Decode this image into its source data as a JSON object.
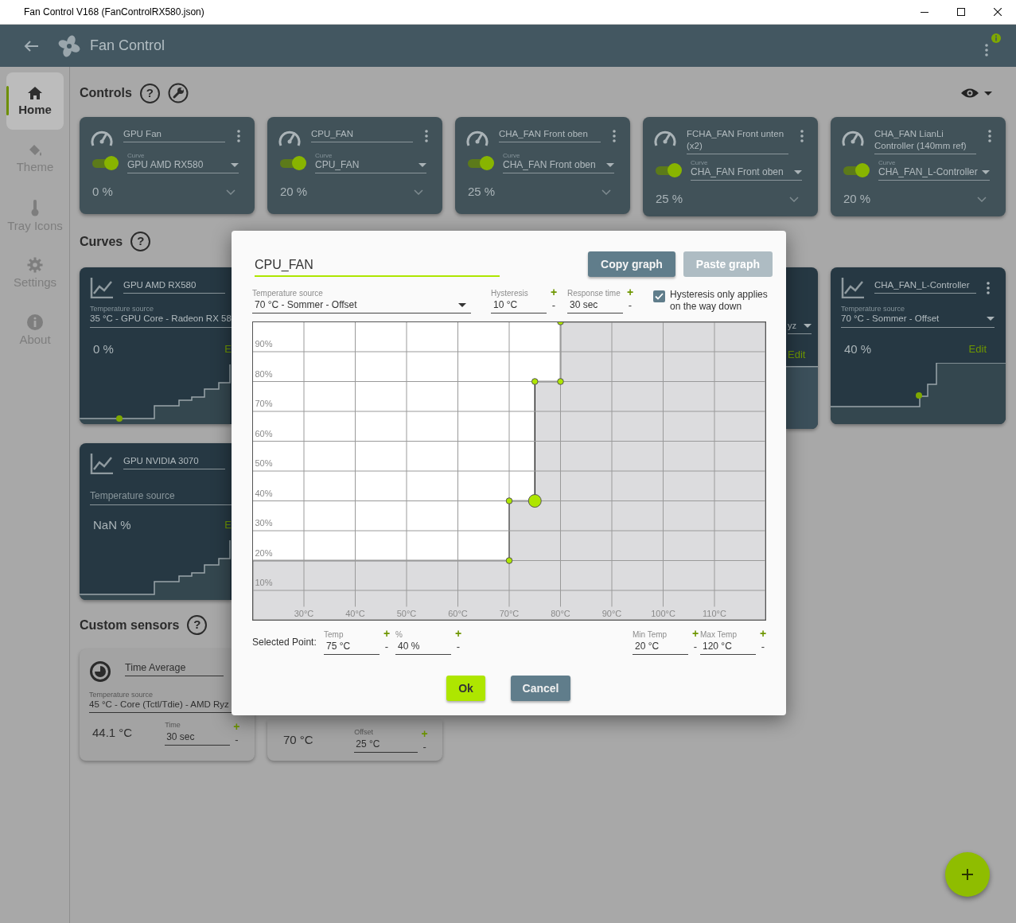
{
  "window": {
    "title": "Fan Control V168 (FanControlRX580.json)"
  },
  "app_bar": {
    "title": "Fan Control"
  },
  "nav": [
    {
      "label": "Home",
      "selected": true
    },
    {
      "label": "Theme",
      "selected": false
    },
    {
      "label": "Tray Icons",
      "selected": false
    },
    {
      "label": "Settings",
      "selected": false
    },
    {
      "label": "About",
      "selected": false
    }
  ],
  "controls": {
    "title": "Controls",
    "help": "?",
    "cards": [
      {
        "name": "GPU Fan",
        "enabled": true,
        "curve_label": "Curve",
        "curve": "GPU AMD RX580",
        "value": "0 %"
      },
      {
        "name": "CPU_FAN",
        "enabled": true,
        "curve_label": "Curve",
        "curve": "CPU_FAN",
        "value": "20 %"
      },
      {
        "name": "CHA_FAN Front oben",
        "enabled": true,
        "curve_label": "Curve",
        "curve": "CHA_FAN Front oben",
        "value": "25 %"
      },
      {
        "name": "FCHA_FAN Front unten (x2)",
        "enabled": true,
        "curve_label": "Curve",
        "curve": "CHA_FAN Front oben",
        "value": "25 %"
      },
      {
        "name": "CHA_FAN LianLi Controller (140mm ref)",
        "enabled": true,
        "curve_label": "Curve",
        "curve": "CHA_FAN_L-Controller",
        "value": "20 %"
      }
    ]
  },
  "curves": {
    "title": "Curves",
    "help": "?",
    "cards": [
      {
        "kind": "cut",
        "name": "GPU AMD RX580",
        "source_label": "Temperature source",
        "source": "35 °C - GPU Core - Radeon RX 58",
        "value": "0 %",
        "edit": "E"
      },
      {
        "kind": "sliver",
        "source": "yz",
        "edit": "Edit"
      },
      {
        "kind": "full",
        "name": "CHA_FAN_L-Controller",
        "source_label": "Temperature source",
        "source": "70 °C - Sommer - Offset",
        "value": "40 %",
        "edit": "Edit"
      },
      {
        "kind": "cut",
        "name": "GPU NVIDIA 3070",
        "placeholder": "Temperature source",
        "value": "NaN %",
        "edit": "E"
      }
    ]
  },
  "custom_sensors": {
    "title": "Custom sensors",
    "help": "?",
    "cards": [
      {
        "kind": "full",
        "name": "Time Average",
        "source_label": "Temperature source",
        "source": "45 °C - Core (Tctl/Tdie) - AMD Ryz",
        "value": "44.1 °C",
        "field_label": "Time",
        "field_value": "30 sec",
        "plus": "+",
        "minus": "-"
      },
      {
        "kind": "strip",
        "value": "70 °C",
        "field_label": "Offset",
        "field_value": "25 °C",
        "plus": "+",
        "minus": "-"
      }
    ]
  },
  "dialog": {
    "name": "CPU_FAN",
    "top_buttons": [
      {
        "label": "Copy graph",
        "disabled": false
      },
      {
        "label": "Paste graph",
        "disabled": true
      }
    ],
    "source": {
      "label": "Temperature source",
      "value": "70 °C - Sommer - Offset"
    },
    "settings": [
      {
        "label": "Hysteresis",
        "value": "10 °C",
        "plus": "+",
        "minus": "-"
      },
      {
        "label": "Response time",
        "value": "30 sec",
        "plus": "+",
        "minus": "-"
      }
    ],
    "hysteresis_down": {
      "label": "Hysteresis only applies on the way down",
      "checked": true
    },
    "graph": {
      "points": [
        {
          "selected": false
        },
        {
          "selected": false
        },
        {
          "selected": true
        },
        {
          "selected": false
        },
        {
          "selected": false
        },
        {
          "selected": false
        }
      ],
      "chart_data": {
        "type": "area",
        "grid": true,
        "x": [
          20,
          70,
          70,
          75,
          75,
          80,
          80,
          120
        ],
        "series": [
          {
            "color": "#dcdcde",
            "values": [
              20,
              20,
              40,
              40,
              80,
              80,
              100,
              100
            ]
          }
        ],
        "xlim": [
          20,
          120
        ],
        "ylim": [
          0,
          100
        ],
        "xticks": [
          {
            "value": 30,
            "label": "30°C"
          },
          {
            "value": 40,
            "label": "40°C"
          },
          {
            "value": 50,
            "label": "50°C"
          },
          {
            "value": 60,
            "label": "60°C"
          },
          {
            "value": 70,
            "label": "70°C"
          },
          {
            "value": 80,
            "label": "80°C"
          },
          {
            "value": 90,
            "label": "90°C"
          },
          {
            "value": 100,
            "label": "100°C"
          },
          {
            "value": 110,
            "label": "110°C"
          }
        ],
        "yticks": [
          {
            "value": 10,
            "label": "10%"
          },
          {
            "value": 20,
            "label": "20%"
          },
          {
            "value": 30,
            "label": "30%"
          },
          {
            "value": 40,
            "label": "40%"
          },
          {
            "value": 50,
            "label": "50%"
          },
          {
            "value": 60,
            "label": "60%"
          },
          {
            "value": 70,
            "label": "70%"
          },
          {
            "value": 80,
            "label": "80%"
          },
          {
            "value": 90,
            "label": "90%"
          }
        ]
      }
    },
    "selected_point": {
      "label": "Selected Point:",
      "fields": [
        {
          "label": "Temp",
          "value": "75 °C",
          "plus": "+",
          "minus": "-"
        },
        {
          "label": "%",
          "value": "40 %",
          "plus": "+",
          "minus": "-"
        }
      ]
    },
    "range_fields": [
      {
        "label": "Min Temp",
        "value": "20 °C",
        "plus": "+",
        "minus": "-"
      },
      {
        "label": "Max Temp",
        "value": "120 °C",
        "plus": "+",
        "minus": "-"
      }
    ],
    "buttons": [
      {
        "label": "Ok",
        "kind": "primary"
      },
      {
        "label": "Cancel",
        "kind": "secondary"
      }
    ]
  }
}
